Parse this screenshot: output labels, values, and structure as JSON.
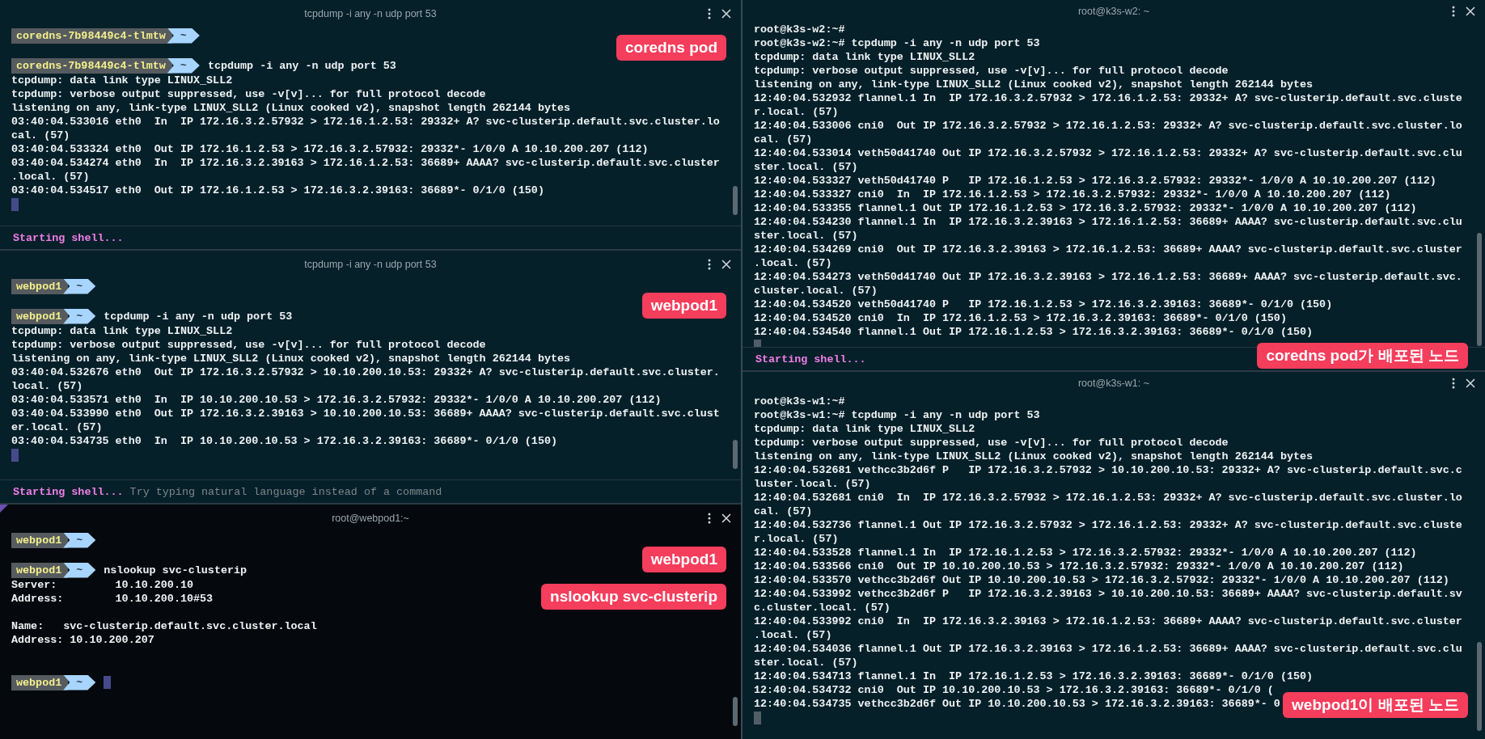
{
  "columns": [
    {
      "panes": [
        {
          "title": "tcpdump -i any -n udp port 53",
          "selected": false,
          "badges": [
            "coredns pod"
          ],
          "lines": [
            {
              "kind": "prompt",
              "host": "coredns-7b98449c4-tlmtw",
              "dir": "~"
            },
            {
              "kind": "blank"
            },
            {
              "kind": "prompt",
              "host": "coredns-7b98449c4-tlmtw",
              "dir": "~",
              "command": "tcpdump -i any -n udp port 53"
            },
            {
              "kind": "text",
              "text": "tcpdump: data link type LINUX_SLL2"
            },
            {
              "kind": "text",
              "text": "tcpdump: verbose output suppressed, use -v[v]... for full protocol decode"
            },
            {
              "kind": "text",
              "text": "listening on any, link-type LINUX_SLL2 (Linux cooked v2), snapshot length 262144 bytes"
            },
            {
              "kind": "text",
              "text": "03:40:04.533016 eth0  In  IP 172.16.3.2.57932 > 172.16.1.2.53: 29332+ A? svc-clusterip.default.svc.cluster.lo"
            },
            {
              "kind": "text",
              "text": "cal. (57)"
            },
            {
              "kind": "text",
              "text": "03:40:04.533324 eth0  Out IP 172.16.1.2.53 > 172.16.3.2.57932: 29332*- 1/0/0 A 10.10.200.207 (112)"
            },
            {
              "kind": "text",
              "text": "03:40:04.534274 eth0  In  IP 172.16.3.2.39163 > 172.16.1.2.53: 36689+ AAAA? svc-clusterip.default.svc.cluster"
            },
            {
              "kind": "text",
              "text": ".local. (57)"
            },
            {
              "kind": "text",
              "text": "03:40:04.534517 eth0  Out IP 172.16.1.2.53 > 172.16.3.2.39163: 36689*- 0/1/0 (150)"
            },
            {
              "kind": "cursor"
            }
          ],
          "footer": {
            "status": "Starting shell..."
          }
        },
        {
          "title": "tcpdump -i any -n udp port 53",
          "selected": false,
          "badges": [
            "webpod1"
          ],
          "lines": [
            {
              "kind": "prompt",
              "host": "webpod1",
              "dir": "~"
            },
            {
              "kind": "blank"
            },
            {
              "kind": "prompt",
              "host": "webpod1",
              "dir": "~",
              "command": "tcpdump -i any -n udp port 53"
            },
            {
              "kind": "text",
              "text": "tcpdump: data link type LINUX_SLL2"
            },
            {
              "kind": "text",
              "text": "tcpdump: verbose output suppressed, use -v[v]... for full protocol decode"
            },
            {
              "kind": "text",
              "text": "listening on any, link-type LINUX_SLL2 (Linux cooked v2), snapshot length 262144 bytes"
            },
            {
              "kind": "text",
              "text": "03:40:04.532676 eth0  Out IP 172.16.3.2.57932 > 10.10.200.10.53: 29332+ A? svc-clusterip.default.svc.cluster."
            },
            {
              "kind": "text",
              "text": "local. (57)"
            },
            {
              "kind": "text",
              "text": "03:40:04.533571 eth0  In  IP 10.10.200.10.53 > 172.16.3.2.57932: 29332*- 1/0/0 A 10.10.200.207 (112)"
            },
            {
              "kind": "text",
              "text": "03:40:04.533990 eth0  Out IP 172.16.3.2.39163 > 10.10.200.10.53: 36689+ AAAA? svc-clusterip.default.svc.clust"
            },
            {
              "kind": "text",
              "text": "er.local. (57)"
            },
            {
              "kind": "text",
              "text": "03:40:04.534735 eth0  In  IP 10.10.200.10.53 > 172.16.3.2.39163: 36689*- 0/1/0 (150)"
            },
            {
              "kind": "cursor"
            }
          ],
          "footer": {
            "status": "Starting shell...",
            "hint": "Try typing natural language instead of a command"
          }
        },
        {
          "title": "root@webpod1:~",
          "selected": true,
          "badges": [
            "webpod1",
            "nslookup svc-clusterip"
          ],
          "lines": [
            {
              "kind": "prompt",
              "host": "webpod1",
              "dir": "~"
            },
            {
              "kind": "blank"
            },
            {
              "kind": "prompt",
              "host": "webpod1",
              "dir": "~",
              "command": "nslookup svc-clusterip"
            },
            {
              "kind": "text",
              "text": "Server:         10.10.200.10"
            },
            {
              "kind": "text",
              "text": "Address:        10.10.200.10#53"
            },
            {
              "kind": "blank"
            },
            {
              "kind": "text",
              "text": "Name:   svc-clusterip.default.svc.cluster.local"
            },
            {
              "kind": "text",
              "text": "Address: 10.10.200.207"
            },
            {
              "kind": "blank"
            },
            {
              "kind": "blank"
            },
            {
              "kind": "input",
              "host": "webpod1",
              "dir": "~"
            }
          ]
        }
      ]
    },
    {
      "panes": [
        {
          "title": "root@k3s-w2: ~",
          "selected": false,
          "badges": [
            "coredns pod가 배포된 노드"
          ],
          "lines": [
            {
              "kind": "text",
              "text": "root@k3s-w2:~#"
            },
            {
              "kind": "text",
              "text": "root@k3s-w2:~# tcpdump -i any -n udp port 53"
            },
            {
              "kind": "text",
              "text": "tcpdump: data link type LINUX_SLL2"
            },
            {
              "kind": "text",
              "text": "tcpdump: verbose output suppressed, use -v[v]... for full protocol decode"
            },
            {
              "kind": "text",
              "text": "listening on any, link-type LINUX_SLL2 (Linux cooked v2), snapshot length 262144 bytes"
            },
            {
              "kind": "text",
              "text": "12:40:04.532932 flannel.1 In  IP 172.16.3.2.57932 > 172.16.1.2.53: 29332+ A? svc-clusterip.default.svc.cluste"
            },
            {
              "kind": "text",
              "text": "r.local. (57)"
            },
            {
              "kind": "text",
              "text": "12:40:04.533006 cni0  Out IP 172.16.3.2.57932 > 172.16.1.2.53: 29332+ A? svc-clusterip.default.svc.cluster.lo"
            },
            {
              "kind": "text",
              "text": "cal. (57)"
            },
            {
              "kind": "text",
              "text": "12:40:04.533014 veth50d41740 Out IP 172.16.3.2.57932 > 172.16.1.2.53: 29332+ A? svc-clusterip.default.svc.clu"
            },
            {
              "kind": "text",
              "text": "ster.local. (57)"
            },
            {
              "kind": "text",
              "text": "12:40:04.533327 veth50d41740 P   IP 172.16.1.2.53 > 172.16.3.2.57932: 29332*- 1/0/0 A 10.10.200.207 (112)"
            },
            {
              "kind": "text",
              "text": "12:40:04.533327 cni0  In  IP 172.16.1.2.53 > 172.16.3.2.57932: 29332*- 1/0/0 A 10.10.200.207 (112)"
            },
            {
              "kind": "text",
              "text": "12:40:04.533355 flannel.1 Out IP 172.16.1.2.53 > 172.16.3.2.57932: 29332*- 1/0/0 A 10.10.200.207 (112)"
            },
            {
              "kind": "text",
              "text": "12:40:04.534230 flannel.1 In  IP 172.16.3.2.39163 > 172.16.1.2.53: 36689+ AAAA? svc-clusterip.default.svc.clu"
            },
            {
              "kind": "text",
              "text": "ster.local. (57)"
            },
            {
              "kind": "text",
              "text": "12:40:04.534269 cni0  Out IP 172.16.3.2.39163 > 172.16.1.2.53: 36689+ AAAA? svc-clusterip.default.svc.cluster"
            },
            {
              "kind": "text",
              "text": ".local. (57)"
            },
            {
              "kind": "text",
              "text": "12:40:04.534273 veth50d41740 Out IP 172.16.3.2.39163 > 172.16.1.2.53: 36689+ AAAA? svc-clusterip.default.svc."
            },
            {
              "kind": "text",
              "text": "cluster.local. (57)"
            },
            {
              "kind": "text",
              "text": "12:40:04.534520 veth50d41740 P   IP 172.16.1.2.53 > 172.16.3.2.39163: 36689*- 0/1/0 (150)"
            },
            {
              "kind": "text",
              "text": "12:40:04.534520 cni0  In  IP 172.16.1.2.53 > 172.16.3.2.39163: 36689*- 0/1/0 (150)"
            },
            {
              "kind": "text",
              "text": "12:40:04.534540 flannel.1 Out IP 172.16.1.2.53 > 172.16.3.2.39163: 36689*- 0/1/0 (150)"
            },
            {
              "kind": "cursor"
            }
          ],
          "footer": {
            "status": "Starting shell..."
          }
        },
        {
          "title": "root@k3s-w1: ~",
          "selected": false,
          "badges": [
            "webpod1이 배포된 노드"
          ],
          "lines": [
            {
              "kind": "text",
              "text": "root@k3s-w1:~#"
            },
            {
              "kind": "text",
              "text": "root@k3s-w1:~# tcpdump -i any -n udp port 53"
            },
            {
              "kind": "text",
              "text": "tcpdump: data link type LINUX_SLL2"
            },
            {
              "kind": "text",
              "text": "tcpdump: verbose output suppressed, use -v[v]... for full protocol decode"
            },
            {
              "kind": "text",
              "text": "listening on any, link-type LINUX_SLL2 (Linux cooked v2), snapshot length 262144 bytes"
            },
            {
              "kind": "text",
              "text": "12:40:04.532681 vethcc3b2d6f P   IP 172.16.3.2.57932 > 10.10.200.10.53: 29332+ A? svc-clusterip.default.svc.c"
            },
            {
              "kind": "text",
              "text": "luster.local. (57)"
            },
            {
              "kind": "text",
              "text": "12:40:04.532681 cni0  In  IP 172.16.3.2.57932 > 172.16.1.2.53: 29332+ A? svc-clusterip.default.svc.cluster.lo"
            },
            {
              "kind": "text",
              "text": "cal. (57)"
            },
            {
              "kind": "text",
              "text": "12:40:04.532736 flannel.1 Out IP 172.16.3.2.57932 > 172.16.1.2.53: 29332+ A? svc-clusterip.default.svc.cluste"
            },
            {
              "kind": "text",
              "text": "r.local. (57)"
            },
            {
              "kind": "text",
              "text": "12:40:04.533528 flannel.1 In  IP 172.16.1.2.53 > 172.16.3.2.57932: 29332*- 1/0/0 A 10.10.200.207 (112)"
            },
            {
              "kind": "text",
              "text": "12:40:04.533566 cni0  Out IP 10.10.200.10.53 > 172.16.3.2.57932: 29332*- 1/0/0 A 10.10.200.207 (112)"
            },
            {
              "kind": "text",
              "text": "12:40:04.533570 vethcc3b2d6f Out IP 10.10.200.10.53 > 172.16.3.2.57932: 29332*- 1/0/0 A 10.10.200.207 (112)"
            },
            {
              "kind": "text",
              "text": "12:40:04.533992 vethcc3b2d6f P   IP 172.16.3.2.39163 > 10.10.200.10.53: 36689+ AAAA? svc-clusterip.default.sv"
            },
            {
              "kind": "text",
              "text": "c.cluster.local. (57)"
            },
            {
              "kind": "text",
              "text": "12:40:04.533992 cni0  In  IP 172.16.3.2.39163 > 172.16.1.2.53: 36689+ AAAA? svc-clusterip.default.svc.cluster"
            },
            {
              "kind": "text",
              "text": ".local. (57)"
            },
            {
              "kind": "text",
              "text": "12:40:04.534036 flannel.1 Out IP 172.16.3.2.39163 > 172.16.1.2.53: 36689+ AAAA? svc-clusterip.default.svc.clu"
            },
            {
              "kind": "text",
              "text": "ster.local. (57)"
            },
            {
              "kind": "text",
              "text": "12:40:04.534713 flannel.1 In  IP 172.16.1.2.53 > 172.16.3.2.39163: 36689*- 0/1/0 (150)"
            },
            {
              "kind": "text",
              "text": "12:40:04.534732 cni0  Out IP 10.10.200.10.53 > 172.16.3.2.39163: 36689*- 0/1/0 ("
            },
            {
              "kind": "text",
              "text": "12:40:04.534735 vethcc3b2d6f Out IP 10.10.200.10.53 > 172.16.3.2.39163: 36689*- 0"
            },
            {
              "kind": "cursor"
            }
          ]
        }
      ]
    }
  ]
}
